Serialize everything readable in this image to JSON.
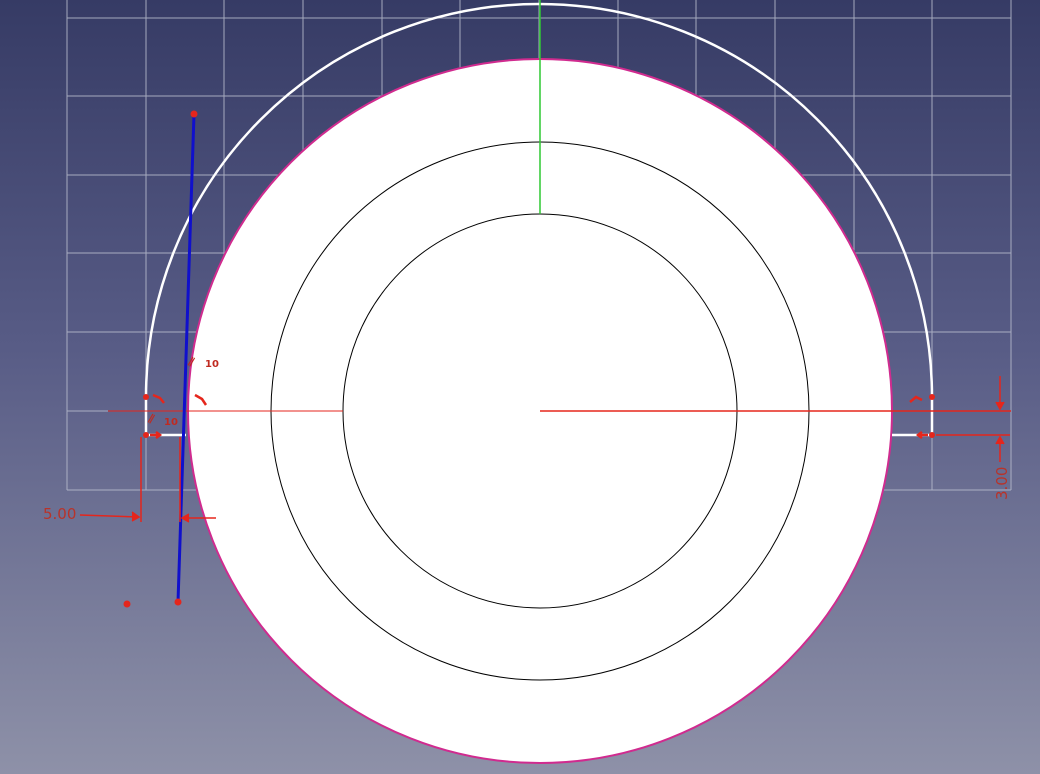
{
  "sketch": {
    "dimensions": [
      {
        "id": "horizontal-distance",
        "label": "5.00"
      },
      {
        "id": "vertical-distance",
        "label": "3.00"
      }
    ],
    "constraint_tags": [
      {
        "id": "parallel-1",
        "symbol": "∥",
        "index": "10"
      },
      {
        "id": "parallel-2",
        "symbol": "∥",
        "index": "10"
      }
    ],
    "colors": {
      "background_top": "#363b65",
      "background_bottom": "#8e91a8",
      "grid": "#b8bccd",
      "sketch_geometry": "#ffffff",
      "selected_edge": "#d02b8f",
      "construction_line": "#1010cc",
      "constraint": "#e5261c",
      "vertical_axis": "#2fc832",
      "horizontal_axis": "#e5261c"
    }
  }
}
